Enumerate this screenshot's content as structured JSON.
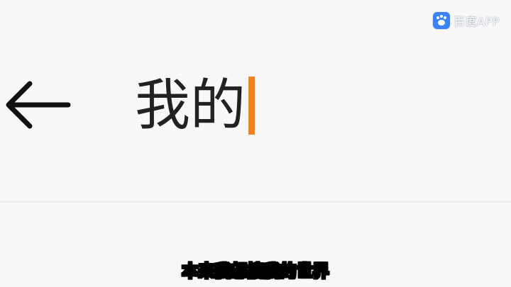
{
  "search": {
    "query": "我的",
    "cursor_color": "#f58220"
  },
  "icons": {
    "back": "back-arrow-icon",
    "watermark_logo": "baidu-paw-icon"
  },
  "watermark": {
    "text": "百度APP",
    "logo_color": "#3b82f6"
  },
  "subtitle": {
    "text": "本来我想搜我的世界"
  },
  "colors": {
    "background": "#f7f7f7",
    "text": "#222222"
  }
}
